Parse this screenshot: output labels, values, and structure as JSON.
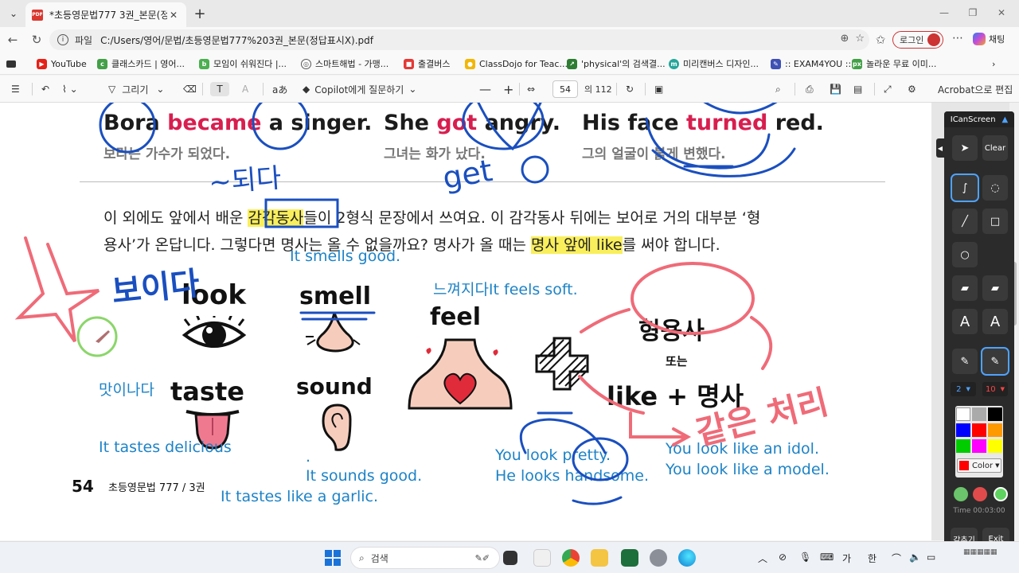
{
  "browser": {
    "tab_title": "*초등영문법777 3권_본문(정답표시X).pdf",
    "file_label": "파일",
    "url": "C:/Users/영어/문법/초등영문법777%203권_본문(정답표시X).pdf",
    "login_label": "로그인",
    "chat_label": "채팅"
  },
  "bookmarks": [
    {
      "label": "YouTube",
      "color": "#e62117"
    },
    {
      "label": "클래스카드 | 영어...",
      "color": "#43a047"
    },
    {
      "label": "모임이 쉬워진다 |...",
      "color": "#4caf50"
    },
    {
      "label": "스마트해법 - 가맹...",
      "color": "#555555"
    },
    {
      "label": "출결버스",
      "color": "#e53935"
    },
    {
      "label": "ClassDojo for Teac...",
      "color": "#f2b705"
    },
    {
      "label": "'physical'의 검색결...",
      "color": "#2e7d32"
    },
    {
      "label": "미리캔버스 디자인...",
      "color": "#26a69a"
    },
    {
      "label": ":: EXAM4YOU ::",
      "color": "#3f51b5"
    },
    {
      "label": "놀라운 무료 이미...",
      "color": "#43a047"
    }
  ],
  "pdf_toolbar": {
    "draw_label": "그리기",
    "copilot_label": "Copilot에게 질문하기",
    "page_current": "54",
    "page_total": "의 112",
    "acrobat_label": "Acrobat으로 편집"
  },
  "page": {
    "examples": [
      {
        "pre": "Bora ",
        "verb": "became",
        "post": " a singer.",
        "ko": "보라는 가수가 되었다."
      },
      {
        "pre": "She ",
        "verb": "got",
        "post": " angry.",
        "ko": "그녀는 화가 났다."
      },
      {
        "pre": "His face ",
        "verb": "turned",
        "post": " red.",
        "ko": "그의 얼굴이 붉게 변했다."
      }
    ],
    "para_line1_a": "이 외에도 앞에서 배운 ",
    "para_line1_hl": "감각동사",
    "para_line1_b": "들이 2형식 문장에서 쓰여요. 이 감각동사 뒤에는 보어로 거의 대부분 ‘형",
    "para_line2_a": "용사’가 온답니다. 그렇다면 명사는 올 수 없을까요? 명사가 올 때는 ",
    "para_line2_hl": "명사 앞에 like",
    "para_line2_b": "를 써야 합니다.",
    "verbs": {
      "look": "look",
      "smell": "smell",
      "feel": "feel",
      "taste": "taste",
      "sound": "sound"
    },
    "adj_box": {
      "top": "형용사",
      "mid": "또는",
      "bottom": "like + 명사"
    },
    "blue_notes": {
      "smells": "It smells good.",
      "feels": "느껴지다It feels soft.",
      "tastes_ko": "맛이나다",
      "tastes": "It tastes delicious",
      "sounds": "It sounds good.",
      "dot": ".",
      "tastes_like": "It tastes like a garlic.",
      "look1": "You look pretty.",
      "look2": "He looks handsome.",
      "like1": "You look like an idol.",
      "like2": "You look like a model."
    },
    "handwriting": {
      "boida": "보이다",
      "doeda": "~되다",
      "get": "get",
      "same": "같은 처리"
    },
    "footer_num": "54",
    "footer_book": "초등영문법 777 / 3권"
  },
  "icanscreen": {
    "title": "ICanScreen",
    "clear": "Clear",
    "width_value": "2",
    "size_value": "10",
    "color_label": "Color",
    "time": "Time 00:03:00",
    "hide_label": "감추기",
    "exit_label": "Exit",
    "swatches": [
      "#ffffff",
      "#aaaaaa",
      "#000000",
      "#0000ff",
      "#ff0000",
      "#ff9900",
      "#00cc00",
      "#ff00ff",
      "#ffff00"
    ]
  },
  "taskbar": {
    "search_label": "검색",
    "ime1": "가",
    "ime2": "한"
  }
}
